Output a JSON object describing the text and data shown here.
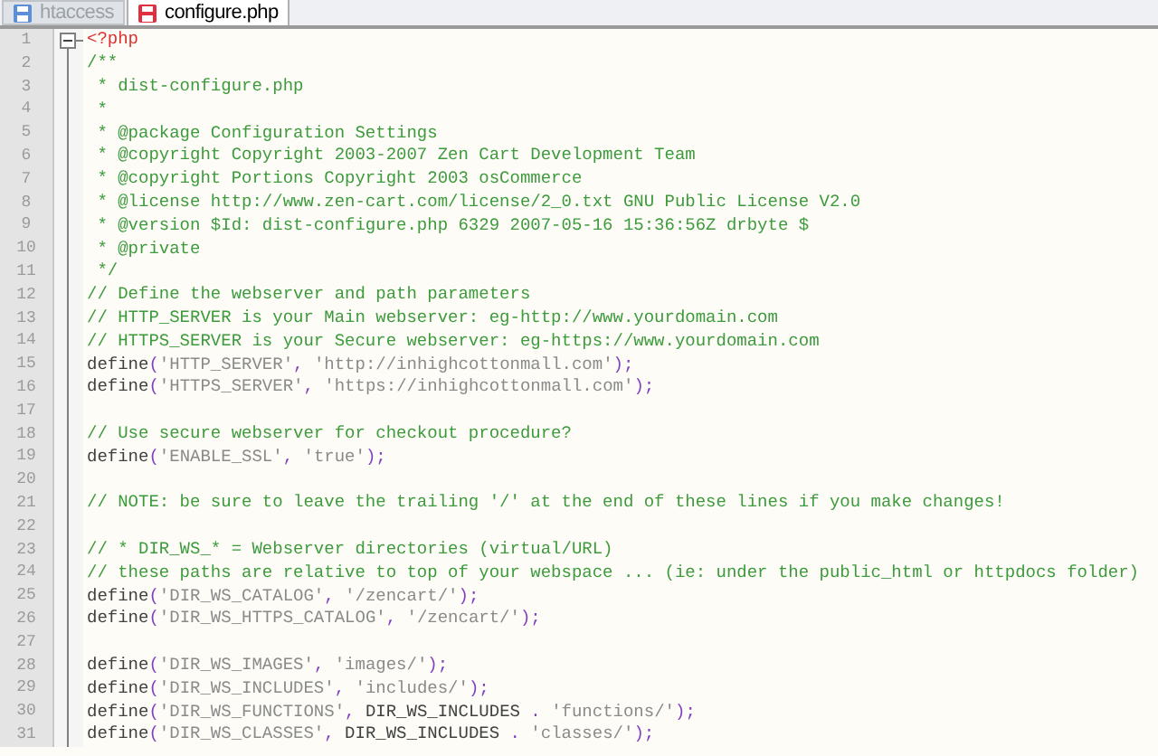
{
  "tabs": [
    {
      "label": "htaccess",
      "selected": false,
      "modified": false
    },
    {
      "label": "configure.php",
      "selected": true,
      "modified": true
    }
  ],
  "editor": {
    "lines": [
      {
        "number": "1",
        "fold_expanded": true,
        "tokens": [
          {
            "kind": "tag",
            "text": "<?php"
          }
        ]
      },
      {
        "number": "2",
        "tokens": [
          {
            "kind": "comment",
            "text": "/**"
          }
        ]
      },
      {
        "number": "3",
        "tokens": [
          {
            "kind": "comment",
            "text": " * dist-configure.php"
          }
        ]
      },
      {
        "number": "4",
        "tokens": [
          {
            "kind": "comment",
            "text": " *"
          }
        ]
      },
      {
        "number": "5",
        "tokens": [
          {
            "kind": "comment",
            "text": " * @package Configuration Settings"
          }
        ]
      },
      {
        "number": "6",
        "tokens": [
          {
            "kind": "comment",
            "text": " * @copyright Copyright 2003-2007 Zen Cart Development Team"
          }
        ]
      },
      {
        "number": "7",
        "tokens": [
          {
            "kind": "comment",
            "text": " * @copyright Portions Copyright 2003 osCommerce"
          }
        ]
      },
      {
        "number": "8",
        "tokens": [
          {
            "kind": "comment",
            "text": " * @license http://www.zen-cart.com/license/2_0.txt GNU Public License V2.0"
          }
        ]
      },
      {
        "number": "9",
        "tokens": [
          {
            "kind": "comment",
            "text": " * @version $Id: dist-configure.php 6329 2007-05-16 15:36:56Z drbyte $"
          }
        ]
      },
      {
        "number": "10",
        "tokens": [
          {
            "kind": "comment",
            "text": " * @private"
          }
        ]
      },
      {
        "number": "11",
        "tokens": [
          {
            "kind": "comment",
            "text": " */"
          }
        ]
      },
      {
        "number": "12",
        "tokens": [
          {
            "kind": "comment",
            "text": "// Define the webserver and path parameters"
          }
        ]
      },
      {
        "number": "13",
        "tokens": [
          {
            "kind": "comment",
            "text": "// HTTP_SERVER is your Main webserver: eg-http://www.yourdomain.com"
          }
        ]
      },
      {
        "number": "14",
        "tokens": [
          {
            "kind": "comment",
            "text": "// HTTPS_SERVER is your Secure webserver: eg-https://www.yourdomain.com"
          }
        ]
      },
      {
        "number": "15",
        "tokens": [
          {
            "kind": "keyword",
            "text": "define"
          },
          {
            "kind": "punct",
            "text": "("
          },
          {
            "kind": "string",
            "text": "'HTTP_SERVER'"
          },
          {
            "kind": "punct",
            "text": ", "
          },
          {
            "kind": "string",
            "text": "'http://inhighcottonmall.com'"
          },
          {
            "kind": "punct",
            "text": ");"
          }
        ]
      },
      {
        "number": "16",
        "tokens": [
          {
            "kind": "keyword",
            "text": "define"
          },
          {
            "kind": "punct",
            "text": "("
          },
          {
            "kind": "string",
            "text": "'HTTPS_SERVER'"
          },
          {
            "kind": "punct",
            "text": ", "
          },
          {
            "kind": "string",
            "text": "'https://inhighcottonmall.com'"
          },
          {
            "kind": "punct",
            "text": ");"
          }
        ]
      },
      {
        "number": "17"
      },
      {
        "number": "18",
        "tokens": [
          {
            "kind": "comment",
            "text": "// Use secure webserver for checkout procedure?"
          }
        ]
      },
      {
        "number": "19",
        "tokens": [
          {
            "kind": "keyword",
            "text": "define"
          },
          {
            "kind": "punct",
            "text": "("
          },
          {
            "kind": "string",
            "text": "'ENABLE_SSL'"
          },
          {
            "kind": "punct",
            "text": ", "
          },
          {
            "kind": "string",
            "text": "'true'"
          },
          {
            "kind": "punct",
            "text": ");"
          }
        ]
      },
      {
        "number": "20"
      },
      {
        "number": "21",
        "tokens": [
          {
            "kind": "comment",
            "text": "// NOTE: be sure to leave the trailing '/' at the end of these lines if you make changes!"
          }
        ]
      },
      {
        "number": "22"
      },
      {
        "number": "23",
        "tokens": [
          {
            "kind": "comment",
            "text": "// * DIR_WS_* = Webserver directories (virtual/URL)"
          }
        ]
      },
      {
        "number": "24",
        "tokens": [
          {
            "kind": "comment",
            "text": "// these paths are relative to top of your webspace ... (ie: under the public_html or httpdocs folder)"
          }
        ]
      },
      {
        "number": "25",
        "tokens": [
          {
            "kind": "keyword",
            "text": "define"
          },
          {
            "kind": "punct",
            "text": "("
          },
          {
            "kind": "string",
            "text": "'DIR_WS_CATALOG'"
          },
          {
            "kind": "punct",
            "text": ", "
          },
          {
            "kind": "string",
            "text": "'/zencart/'"
          },
          {
            "kind": "punct",
            "text": ");"
          }
        ]
      },
      {
        "number": "26",
        "tokens": [
          {
            "kind": "keyword",
            "text": "define"
          },
          {
            "kind": "punct",
            "text": "("
          },
          {
            "kind": "string",
            "text": "'DIR_WS_HTTPS_CATALOG'"
          },
          {
            "kind": "punct",
            "text": ", "
          },
          {
            "kind": "string",
            "text": "'/zencart/'"
          },
          {
            "kind": "punct",
            "text": ");"
          }
        ]
      },
      {
        "number": "27"
      },
      {
        "number": "28",
        "tokens": [
          {
            "kind": "keyword",
            "text": "define"
          },
          {
            "kind": "punct",
            "text": "("
          },
          {
            "kind": "string",
            "text": "'DIR_WS_IMAGES'"
          },
          {
            "kind": "punct",
            "text": ", "
          },
          {
            "kind": "string",
            "text": "'images/'"
          },
          {
            "kind": "punct",
            "text": ");"
          }
        ]
      },
      {
        "number": "29",
        "tokens": [
          {
            "kind": "keyword",
            "text": "define"
          },
          {
            "kind": "punct",
            "text": "("
          },
          {
            "kind": "string",
            "text": "'DIR_WS_INCLUDES'"
          },
          {
            "kind": "punct",
            "text": ", "
          },
          {
            "kind": "string",
            "text": "'includes/'"
          },
          {
            "kind": "punct",
            "text": ");"
          }
        ]
      },
      {
        "number": "30",
        "tokens": [
          {
            "kind": "keyword",
            "text": "define"
          },
          {
            "kind": "punct",
            "text": "("
          },
          {
            "kind": "string",
            "text": "'DIR_WS_FUNCTIONS'"
          },
          {
            "kind": "punct",
            "text": ", "
          },
          {
            "kind": "keyword",
            "text": "DIR_WS_INCLUDES"
          },
          {
            "kind": "punct",
            "text": " . "
          },
          {
            "kind": "string",
            "text": "'functions/'"
          },
          {
            "kind": "punct",
            "text": ");"
          }
        ]
      },
      {
        "number": "31",
        "tokens": [
          {
            "kind": "keyword",
            "text": "define"
          },
          {
            "kind": "punct",
            "text": "("
          },
          {
            "kind": "string",
            "text": "'DIR_WS_CLASSES'"
          },
          {
            "kind": "punct",
            "text": ", "
          },
          {
            "kind": "keyword",
            "text": "DIR_WS_INCLUDES"
          },
          {
            "kind": "punct",
            "text": " . "
          },
          {
            "kind": "string",
            "text": "'classes/'"
          },
          {
            "kind": "punct",
            "text": ");"
          }
        ]
      }
    ]
  }
}
